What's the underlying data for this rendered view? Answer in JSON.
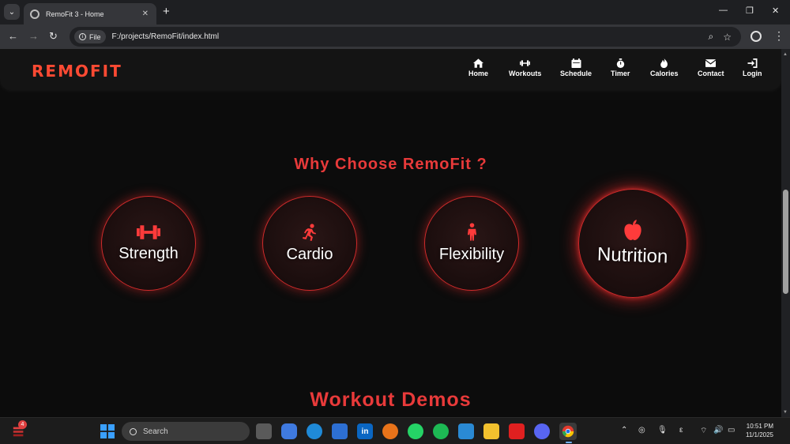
{
  "browser": {
    "tab_title": "RemoFit 3 - Home",
    "tab_close": "✕",
    "new_tab": "+",
    "site_chip": "File",
    "url": "F:/projects/RemoFit/index.html",
    "minimize": "—",
    "maximize": "❐",
    "close": "✕"
  },
  "site": {
    "brand": "REMOFIT",
    "nav": [
      {
        "label": "Home",
        "icon": "home-icon"
      },
      {
        "label": "Workouts",
        "icon": "dumbbell-icon"
      },
      {
        "label": "Schedule",
        "icon": "calendar-icon"
      },
      {
        "label": "Timer",
        "icon": "stopwatch-icon"
      },
      {
        "label": "Calories",
        "icon": "fire-icon"
      },
      {
        "label": "Contact",
        "icon": "envelope-icon"
      },
      {
        "label": "Login",
        "icon": "login-icon"
      }
    ],
    "why_title": "Why Choose RemoFit ?",
    "features": [
      {
        "label": "Strength",
        "icon": "dumbbell-icon"
      },
      {
        "label": "Cardio",
        "icon": "running-icon"
      },
      {
        "label": "Flexibility",
        "icon": "person-icon"
      },
      {
        "label": "Nutrition",
        "icon": "apple-icon"
      }
    ],
    "demos_title": "Workout Demos"
  },
  "taskbar": {
    "search_placeholder": "Search",
    "badge_count": "4",
    "time": "10:51 PM",
    "date": "11/1/2025",
    "lang": "ε"
  },
  "colors": {
    "accent": "#e83a3a",
    "brand": "#ff4a33",
    "background": "#0c0c0c"
  }
}
